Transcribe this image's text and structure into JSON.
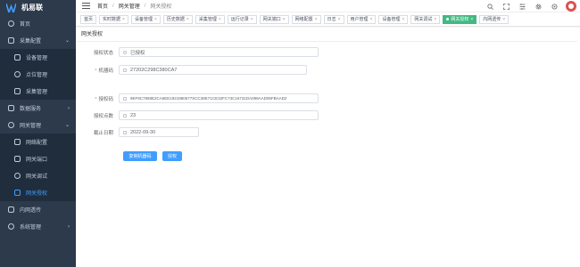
{
  "app": {
    "name": "机易联"
  },
  "sidebar": {
    "items": [
      {
        "label": "首页",
        "icon": "dashboard-icon",
        "sub": false,
        "arrow": ""
      },
      {
        "label": "采集配置",
        "icon": "config-icon",
        "sub": false,
        "arrow": "⌄"
      },
      {
        "label": "设备管理",
        "icon": "device-icon",
        "sub": true,
        "arrow": ""
      },
      {
        "label": "点位管理",
        "icon": "point-icon",
        "sub": true,
        "arrow": ""
      },
      {
        "label": "采集管理",
        "icon": "collect-icon",
        "sub": true,
        "arrow": ""
      },
      {
        "label": "数据服务",
        "icon": "data-icon",
        "sub": false,
        "arrow": "›"
      },
      {
        "label": "网关管理",
        "icon": "gateway-icon",
        "sub": false,
        "arrow": "⌄"
      },
      {
        "label": "网络配置",
        "icon": "network-icon",
        "sub": true,
        "arrow": ""
      },
      {
        "label": "网关端口",
        "icon": "port-icon",
        "sub": true,
        "arrow": ""
      },
      {
        "label": "网关调试",
        "icon": "debug-icon",
        "sub": true,
        "arrow": ""
      },
      {
        "label": "网关授权",
        "icon": "auth-icon",
        "sub": true,
        "arrow": "",
        "active": true
      },
      {
        "label": "内网透传",
        "icon": "tunnel-icon",
        "sub": false,
        "arrow": ""
      },
      {
        "label": "系统管理",
        "icon": "system-icon",
        "sub": false,
        "arrow": "›"
      }
    ]
  },
  "breadcrumb": [
    "首页",
    "网关管理",
    "网关授权"
  ],
  "tags": [
    {
      "label": "首页",
      "active": false,
      "closable": false
    },
    {
      "label": "实时数据",
      "active": false,
      "closable": true
    },
    {
      "label": "设备管理",
      "active": false,
      "closable": true
    },
    {
      "label": "历史数据",
      "active": false,
      "closable": true
    },
    {
      "label": "采集管理",
      "active": false,
      "closable": true
    },
    {
      "label": "运行记录",
      "active": false,
      "closable": true
    },
    {
      "label": "网关端口",
      "active": false,
      "closable": true
    },
    {
      "label": "网络配置",
      "active": false,
      "closable": true
    },
    {
      "label": "日志",
      "active": false,
      "closable": true
    },
    {
      "label": "用户管理",
      "active": false,
      "closable": true
    },
    {
      "label": "设备管理",
      "active": false,
      "closable": true
    },
    {
      "label": "网关调试",
      "active": false,
      "closable": true
    },
    {
      "label": "网关授权",
      "active": true,
      "closable": true
    },
    {
      "label": "内网透传",
      "active": false,
      "closable": true
    }
  ],
  "page": {
    "title": "网关授权",
    "fields": {
      "status": {
        "label": "授权状态",
        "required": false,
        "value": "已授权"
      },
      "machine_code": {
        "label": "机器码",
        "required": true,
        "value": "27202C298C380CA7"
      },
      "auth_code": {
        "label": "授权码",
        "required": true,
        "value": "9EF9C7858E2CA5EE1921980577SCC38E71CE32FC73C16731DA099AAD05FBAAD2"
      },
      "point_count": {
        "label": "授权点数",
        "required": false,
        "value": "23"
      },
      "expire_date": {
        "label": "截止日期",
        "required": false,
        "value": "2022-09-30"
      }
    },
    "buttons": {
      "copy": "复制机器码",
      "authorize": "授权"
    }
  },
  "colors": {
    "sidebar_bg": "#2d3a4b",
    "active_tag": "#42b983",
    "primary": "#409eff",
    "required": "#f56c6c"
  }
}
